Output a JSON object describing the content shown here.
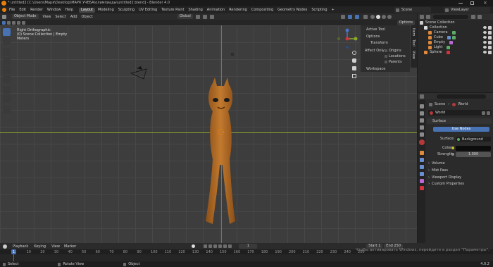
{
  "window": {
    "title": "* untitled2 [C:\\Users\\Маря\\Desktop\\МАРК УЧЕБА\\олимпиады\\untitled2.blend] - Blender 4.0"
  },
  "menu": {
    "items": [
      "File",
      "Edit",
      "Render",
      "Window",
      "Help"
    ],
    "workspaces": [
      "Layout",
      "Modeling",
      "Sculpting",
      "UV Editing",
      "Texture Paint",
      "Shading",
      "Animation",
      "Rendering",
      "Compositing",
      "Geometry Nodes",
      "Scripting"
    ],
    "active_workspace": "Layout",
    "scene_label": "Scene",
    "view_layer": "ViewLayer"
  },
  "viewport_header": {
    "mode": "Object Mode",
    "items": [
      "View",
      "Select",
      "Add",
      "Object"
    ],
    "orientation": "Global",
    "options": "Options"
  },
  "viewport": {
    "overlay_lines": [
      "Right Orthographic",
      "(0) Scene Collection | Empty",
      "Meters"
    ]
  },
  "npanel": {
    "tabs": [
      "Item",
      "Tool",
      "View"
    ],
    "active_tool": "Active Tool",
    "options": "Options",
    "transform": "Transform",
    "affect_only": "Affect Only",
    "checks": [
      "Origins",
      "Locations",
      "Parents"
    ],
    "workspace": "Workspace"
  },
  "outliner": {
    "root": "Scene Collection",
    "collection": "Collection",
    "items": [
      "Camera",
      "Cube",
      "Empty",
      "Light"
    ],
    "sphere": "Sphere"
  },
  "properties": {
    "breadcrumb": [
      "Scene",
      "World"
    ],
    "world_name": "World",
    "surface_panel": "Surface",
    "use_nodes": "Use Nodes",
    "surface_label": "Surface",
    "surface_value": "Background",
    "color_label": "Color",
    "strength_label": "Strength",
    "strength_value": "1.000",
    "collapsed_panels": [
      "Volume",
      "Mist Pass",
      "Viewport Display",
      "Custom Properties"
    ]
  },
  "timeline": {
    "menu": [
      "Playback",
      "Keying",
      "View",
      "Marker"
    ],
    "current_frame": "1",
    "start_label": "Start",
    "start": "1",
    "end_label": "End",
    "end": "250",
    "ticks": [
      "0",
      "10",
      "20",
      "30",
      "40",
      "50",
      "60",
      "70",
      "80",
      "90",
      "100",
      "110",
      "120",
      "130",
      "140",
      "150",
      "160",
      "170",
      "180",
      "190",
      "200",
      "210",
      "220",
      "230",
      "240",
      "250"
    ]
  },
  "activation": {
    "line1": "Чтобы активировать Windows, перейдите в раздел \"Параметры\"."
  },
  "statusbar": {
    "select": "Select",
    "rotate": "Rotate View",
    "object": "Object",
    "version": "4.0.2"
  },
  "colors": {
    "accent": "#4772b3",
    "horse": "#b36a24",
    "axis_y": "#8aab2a",
    "axis_z": "#4a74c9"
  }
}
